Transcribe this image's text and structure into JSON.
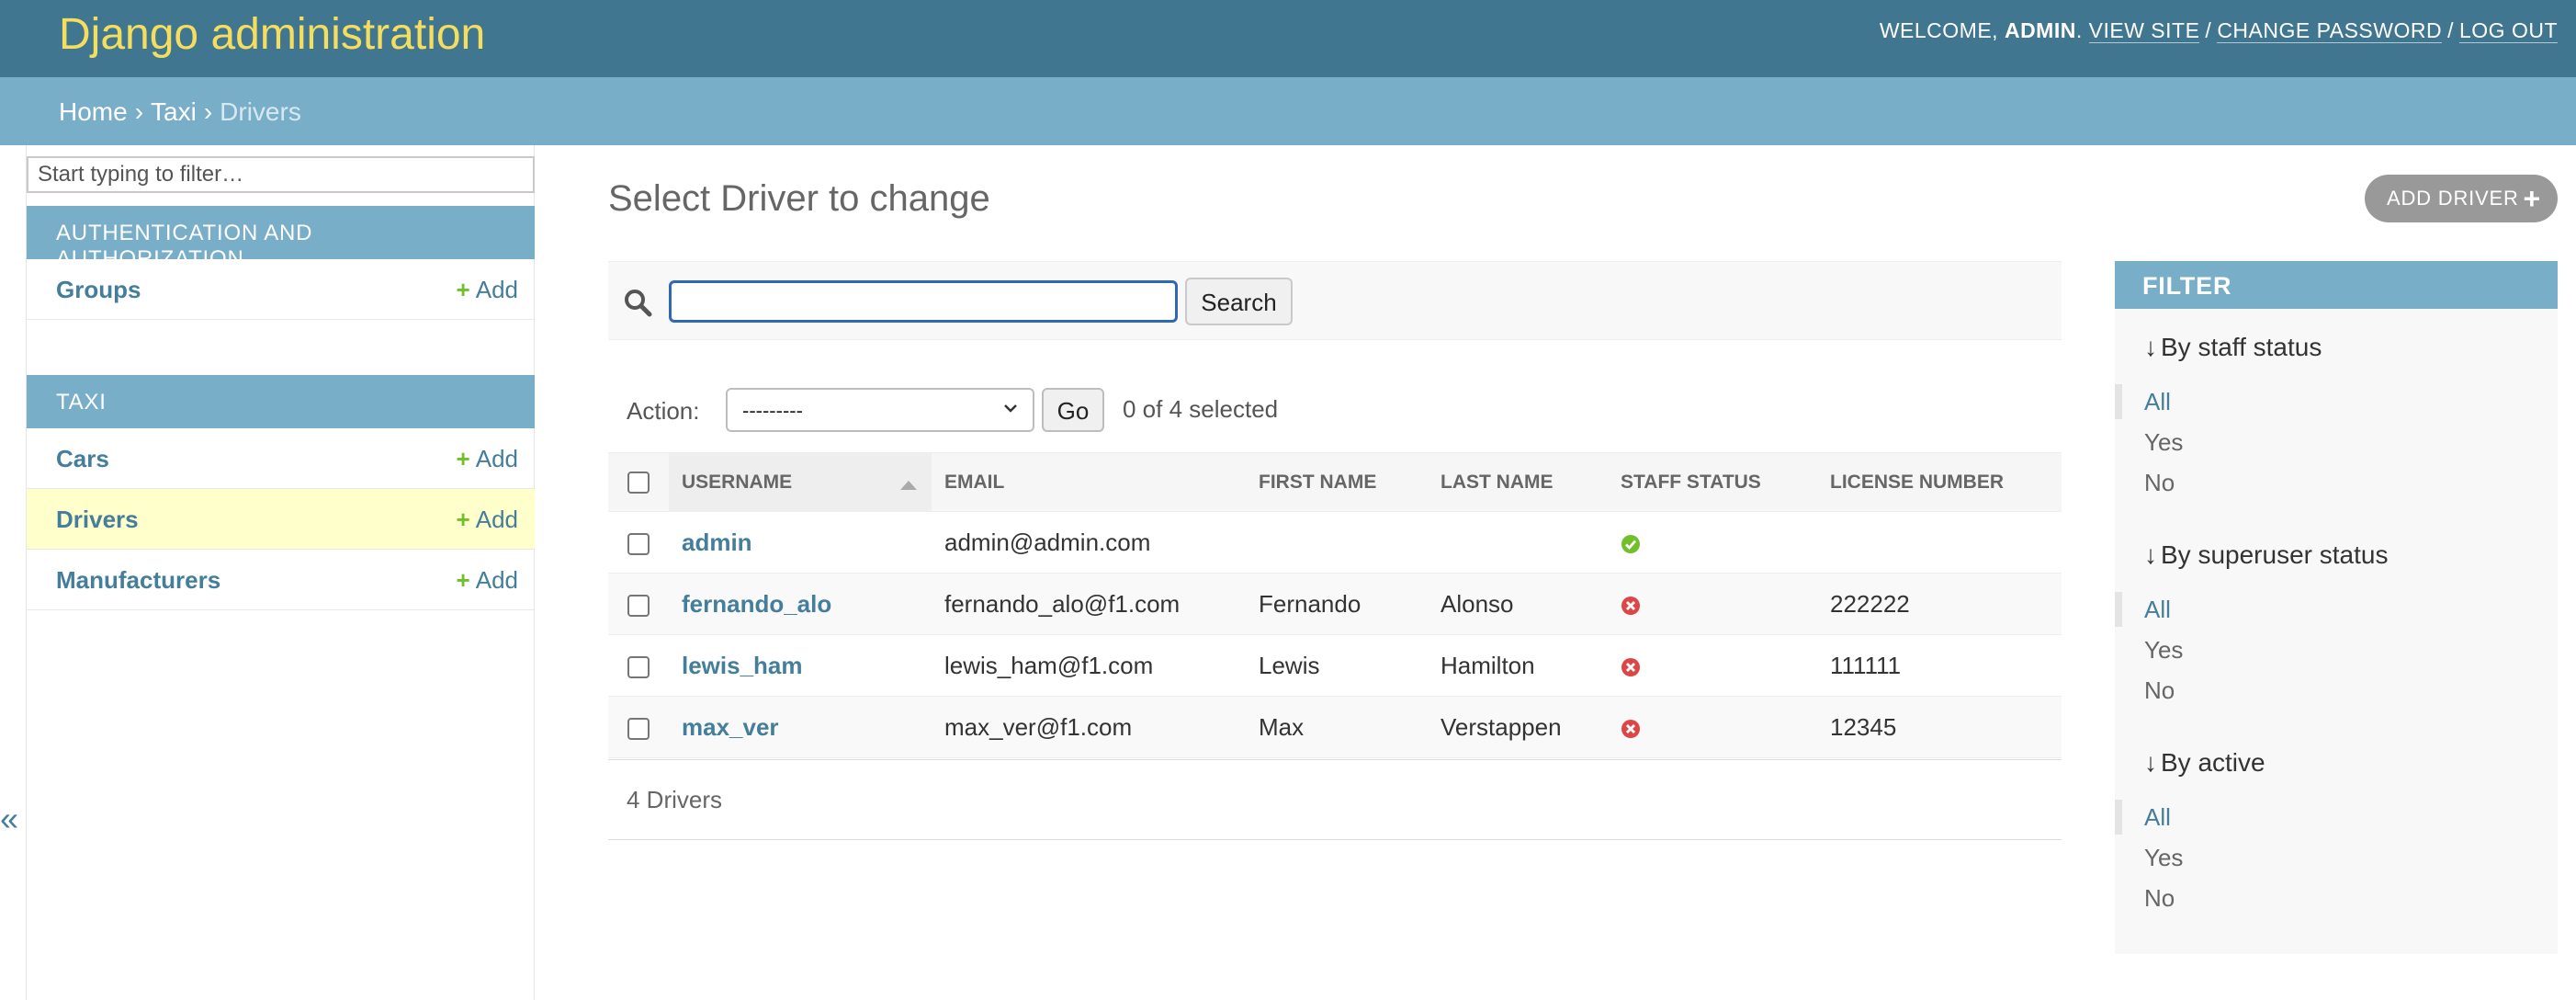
{
  "header": {
    "brand": "Django administration",
    "welcome": "Welcome,",
    "username": "admin",
    "view_site": "View site",
    "change_password": "Change password",
    "log_out": "Log out"
  },
  "breadcrumbs": {
    "home": "Home",
    "app": "Taxi",
    "current": "Drivers",
    "separator": "›"
  },
  "sidebar": {
    "filter_placeholder": "Start typing to filter…",
    "modules": [
      {
        "caption": "Authentication and Authorization",
        "models": [
          {
            "name": "Groups",
            "add": "Add"
          }
        ]
      },
      {
        "caption": "Taxi",
        "models": [
          {
            "name": "Cars",
            "add": "Add"
          },
          {
            "name": "Drivers",
            "add": "Add",
            "active": true
          },
          {
            "name": "Manufacturers",
            "add": "Add"
          }
        ]
      }
    ],
    "collapse": "«"
  },
  "main": {
    "title": "Select Driver to change",
    "add_button": "Add Driver",
    "search_value": "",
    "search_button": "Search",
    "action_label": "Action:",
    "action_selected": "---------",
    "go_button": "Go",
    "selection_count": "0 of 4 selected",
    "columns": [
      "Username",
      "Email",
      "First name",
      "Last name",
      "Staff status",
      "License number"
    ],
    "rows": [
      {
        "username": "admin",
        "email": "admin@admin.com",
        "first_name": "",
        "last_name": "",
        "staff": true,
        "license": ""
      },
      {
        "username": "fernando_alo",
        "email": "fernando_alo@f1.com",
        "first_name": "Fernando",
        "last_name": "Alonso",
        "staff": false,
        "license": "222222"
      },
      {
        "username": "lewis_ham",
        "email": "lewis_ham@f1.com",
        "first_name": "Lewis",
        "last_name": "Hamilton",
        "staff": false,
        "license": "111111"
      },
      {
        "username": "max_ver",
        "email": "max_ver@f1.com",
        "first_name": "Max",
        "last_name": "Verstappen",
        "staff": false,
        "license": "12345"
      }
    ],
    "paginator": "4 Drivers"
  },
  "filter": {
    "caption": "Filter",
    "groups": [
      {
        "title": "By staff status",
        "options": [
          "All",
          "Yes",
          "No"
        ]
      },
      {
        "title": "By superuser status",
        "options": [
          "All",
          "Yes",
          "No"
        ]
      },
      {
        "title": "By active",
        "options": [
          "All",
          "Yes",
          "No"
        ]
      }
    ]
  },
  "colors": {
    "header": "#417690",
    "brand": "#f5dd5d",
    "breadcrumbs": "#79aec8",
    "link": "#447e9b",
    "add_plus": "#70bf2b",
    "active_row": "#ffffcc",
    "yes_icon": "#70bf2b",
    "no_icon": "#dd4646"
  }
}
